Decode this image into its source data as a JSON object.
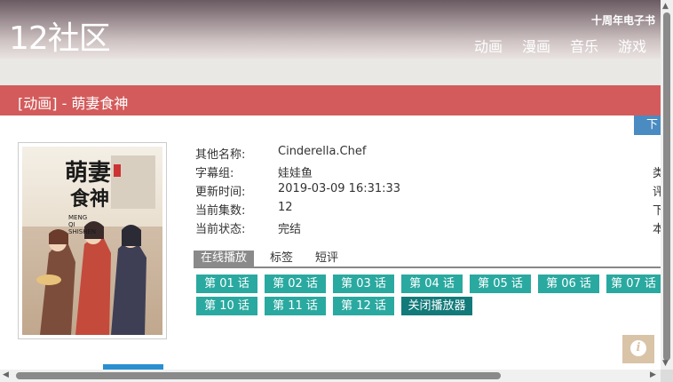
{
  "header": {
    "logo": "12社区",
    "top_link": "十周年电子书",
    "nav": [
      "动画",
      "漫画",
      "音乐",
      "游戏"
    ]
  },
  "title": "[动画] - 萌妻食神",
  "download_label": "下",
  "cover": {
    "title_art": "萌妻食神",
    "romaji": "MENG QI SHISHEN"
  },
  "info": [
    {
      "label": "其他名称:",
      "value": "Cinderella.Chef",
      "right": ""
    },
    {
      "label": "字幕组:",
      "value": "娃娃鱼",
      "right": "类"
    },
    {
      "label": "更新时间:",
      "value": "2019-03-09 16:31:33",
      "right": "评"
    },
    {
      "label": "当前集数:",
      "value": "12",
      "right": "下"
    },
    {
      "label": "当前状态:",
      "value": "完结",
      "right": "本"
    }
  ],
  "tabs": [
    "在线播放",
    "标签",
    "短评"
  ],
  "episodes_row1": [
    "第 01 话",
    "第 02 话",
    "第 03 话",
    "第 04 话",
    "第 05 话",
    "第 06 话",
    "第 07 话"
  ],
  "episodes_row2": [
    "第 10 话",
    "第 11 话",
    "第 12 话"
  ],
  "close_player": "关闭播放器",
  "colors": {
    "title_bar": "#d35b5b",
    "episode_button": "#2aa9a0",
    "close_button": "#137a7a",
    "download": "#4a8bc2",
    "active_tab": "#8a8a8a"
  }
}
